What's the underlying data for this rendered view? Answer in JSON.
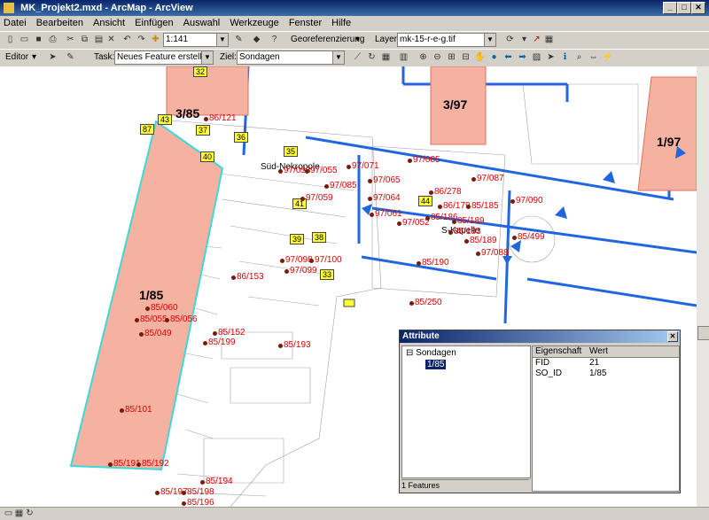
{
  "window": {
    "title": "MK_Projekt2.mxd - ArcMap - ArcView"
  },
  "menu": [
    "Datei",
    "Bearbeiten",
    "Ansicht",
    "Einfügen",
    "Auswahl",
    "Werkzeuge",
    "Fenster",
    "Hilfe"
  ],
  "toolbar1": {
    "scale": "1:141",
    "georef_label": "Georeferenzierung",
    "layer_label": "Layer:",
    "layer_value": "mk-15-r-e-g.tif"
  },
  "toolbar2": {
    "editor_label": "Editor",
    "task_label": "Task:",
    "task_value": "Neues Feature erstellen",
    "target_label": "Ziel:",
    "target_value": "Sondagen"
  },
  "map": {
    "big_labels": [
      "3/85",
      "3/97",
      "1/97",
      "1/85"
    ],
    "numbered_boxes": [
      "32",
      "43",
      "87",
      "37",
      "36",
      "40",
      "35",
      "41",
      "44",
      "39",
      "38",
      "33"
    ],
    "sondage_labels": [
      "86/121",
      "97/085",
      "97/071",
      "97/053",
      "97/055",
      "97/065",
      "97/087",
      "97/059",
      "97/085",
      "86/278",
      "97/064",
      "86/179",
      "85/185",
      "97/061",
      "97/090",
      "97/052",
      "85/186",
      "85/189",
      "85/183",
      "85/189",
      "85/499",
      "97/088",
      "97/098",
      "97/100",
      "97/099",
      "85/190",
      "86/153",
      "85/250",
      "85/060",
      "85/055",
      "85/056",
      "85/049",
      "85/152",
      "85/199",
      "85/193",
      "85/101",
      "85/191",
      "85/192",
      "85/197",
      "85/198",
      "85/194",
      "85/196"
    ],
    "place_labels": [
      "Süd-Nekropole",
      "S-Kapelle"
    ]
  },
  "attribute_window": {
    "title": "Attribute",
    "tree_root": "Sondagen",
    "tree_child": "1/85",
    "feature_count": "1 Features",
    "headers": {
      "property": "Eigenschaft",
      "value": "Wert"
    },
    "rows": [
      {
        "property": "FID",
        "value": "21"
      },
      {
        "property": "SO_ID",
        "value": "1/85"
      }
    ]
  },
  "colors": {
    "accent": "#0a246a",
    "sondage_fill": "#f5b2a0",
    "trench_blue": "#2266dd",
    "label_red": "#e00000"
  }
}
